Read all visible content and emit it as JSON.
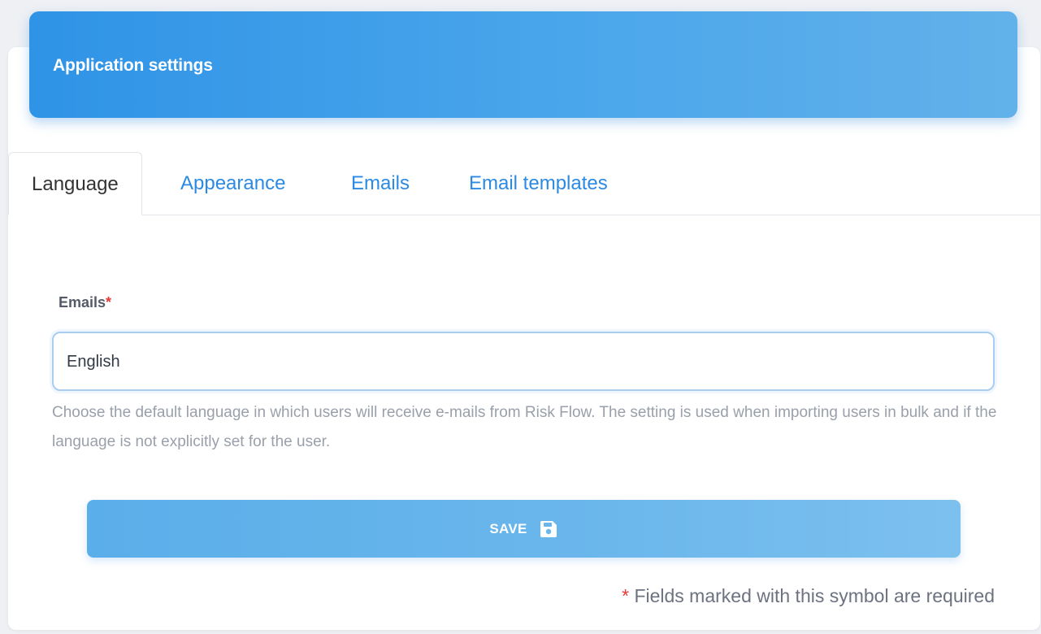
{
  "header": {
    "title": "Application settings"
  },
  "tabs": [
    {
      "label": "Language",
      "active": true
    },
    {
      "label": "Appearance",
      "active": false
    },
    {
      "label": "Emails",
      "active": false
    },
    {
      "label": "Email templates",
      "active": false
    }
  ],
  "form": {
    "field_label": "Emails",
    "required_marker": "*",
    "select_value": "English",
    "help_text": "Choose the default language in which users will receive e-mails from Risk Flow. The setting is used when importing users in bulk and if the language is not explicitly set for the user.",
    "save_label": "SAVE",
    "save_icon": "floppy-disk-icon",
    "required_note_marker": "*",
    "required_note": "Fields marked with this symbol are required"
  },
  "colors": {
    "accent": "#2f93e6",
    "required": "#e53935",
    "tab_link": "#2b8ae3"
  }
}
